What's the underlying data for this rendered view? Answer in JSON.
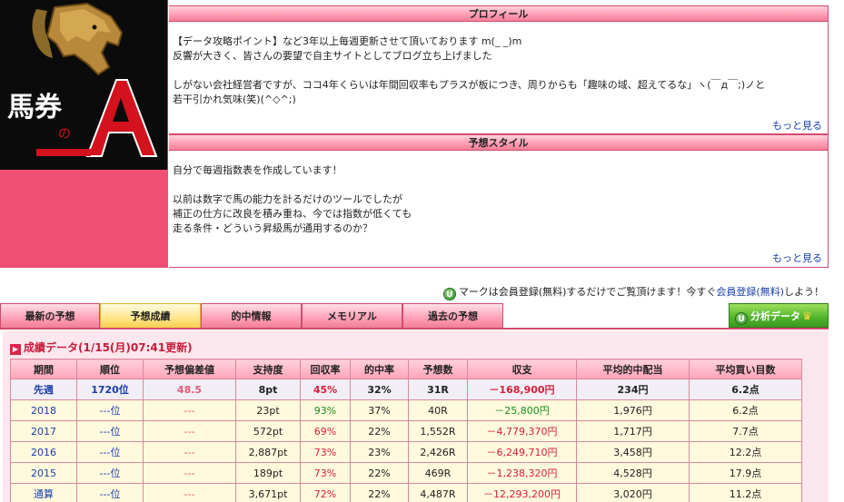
{
  "logo": {
    "text_main": "馬券",
    "text_small": "の",
    "text_letter": "A"
  },
  "profile": {
    "header": "プロフィール",
    "lines": [
      "【データ攻略ポイント】など3年以上毎週更新させて頂いております m(_ _)m",
      "反響が大きく、皆さんの要望で自主サイトとしてブログ立ち上げました",
      "",
      "しがない会社経営者ですが、ココ4年くらいは年間回収率もプラスが板につき、周りからも「趣味の域、超えてるな」ヽ(￣д￣;)ノと",
      "若干引かれ気味(笑)(^◇^;)"
    ],
    "more": "もっと見る"
  },
  "style": {
    "header": "予想スタイル",
    "lines": [
      "自分で毎週指数表を作成しています！",
      "",
      "以前は数字で馬の能力を計るだけのツールでしたが",
      "補正の仕方に改良を積み重ね、今では指数が低くても",
      "走る条件・どういう昇級馬が通用するのか？"
    ],
    "more": "もっと見る"
  },
  "notice": {
    "badge": "U",
    "before": "マークは会員登録(無料)するだけでご覧頂けます！今すぐ",
    "link": "会員登録(無料)",
    "after": "しよう！"
  },
  "tabs": [
    {
      "label": "最新の予想",
      "active": false
    },
    {
      "label": "予想成績",
      "active": true
    },
    {
      "label": "的中情報",
      "active": false
    },
    {
      "label": "メモリアル",
      "active": false
    },
    {
      "label": "過去の予想",
      "active": false
    }
  ],
  "analysis_tab": {
    "badge": "U",
    "label": "分析データ",
    "crown": "♛"
  },
  "results": {
    "title": "成績データ(1/15(月)07:41更新)",
    "columns": [
      "期間",
      "順位",
      "予想偏差値",
      "支持度",
      "回収率",
      "的中率",
      "予想数",
      "収支",
      "平均的中配当",
      "平均買い目数"
    ],
    "main_row": [
      "先週",
      "1720位",
      "48.5",
      "8pt",
      "45%",
      "32%",
      "31R",
      "－168,900円",
      "234円",
      "6.2点"
    ],
    "rows": [
      [
        "2018",
        "---位",
        "---",
        "23pt",
        "93%",
        "37%",
        "40R",
        "－25,800円",
        "1,976円",
        "6.2点"
      ],
      [
        "2017",
        "---位",
        "---",
        "572pt",
        "69%",
        "22%",
        "1,552R",
        "－4,779,370円",
        "1,717円",
        "7.7点"
      ],
      [
        "2016",
        "---位",
        "---",
        "2,887pt",
        "73%",
        "23%",
        "2,426R",
        "－6,249,710円",
        "3,458円",
        "12.2点"
      ],
      [
        "2015",
        "---位",
        "---",
        "189pt",
        "73%",
        "22%",
        "469R",
        "－1,238,320円",
        "4,528円",
        "17.9点"
      ],
      [
        "通算",
        "---位",
        "---",
        "3,671pt",
        "72%",
        "22%",
        "4,487R",
        "－12,293,200円",
        "3,020円",
        "11.2点"
      ]
    ]
  }
}
